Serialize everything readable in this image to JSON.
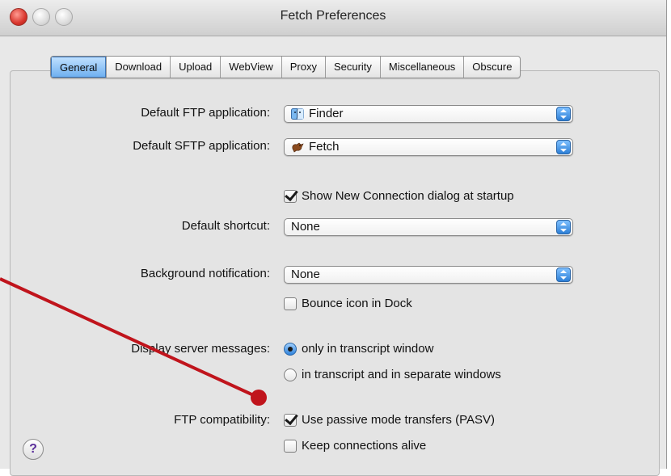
{
  "window": {
    "title": "Fetch Preferences"
  },
  "tabs": [
    "General",
    "Download",
    "Upload",
    "WebView",
    "Proxy",
    "Security",
    "Miscellaneous",
    "Obscure"
  ],
  "selected_tab": "General",
  "fields": {
    "ftp_app": {
      "label": "Default FTP application:",
      "value": "Finder",
      "icon": "finder-icon"
    },
    "sftp_app": {
      "label": "Default SFTP application:",
      "value": "Fetch",
      "icon": "fetch-dog-icon"
    },
    "show_new_conn": {
      "label": "Show New Connection dialog at startup",
      "checked": true
    },
    "default_shortcut": {
      "label": "Default shortcut:",
      "value": "None"
    },
    "background_notification": {
      "label": "Background notification:",
      "value": "None"
    },
    "bounce_icon": {
      "label": "Bounce icon in Dock",
      "checked": false
    },
    "server_messages": {
      "label": "Display server messages:",
      "options": [
        "only in transcript window",
        "in transcript and in separate windows"
      ],
      "selected": "only in transcript window"
    },
    "ftp_compat": {
      "label": "FTP compatibility:"
    },
    "passive_mode": {
      "label": "Use passive mode transfers (PASV)",
      "checked": true
    },
    "keep_alive": {
      "label": "Keep connections alive",
      "checked": false
    }
  },
  "help_button": {
    "label": "?"
  },
  "annotation": {
    "color": "#c0141c"
  },
  "colors": {
    "accent": "#2d7fd6",
    "close_button": "#d9352c"
  }
}
